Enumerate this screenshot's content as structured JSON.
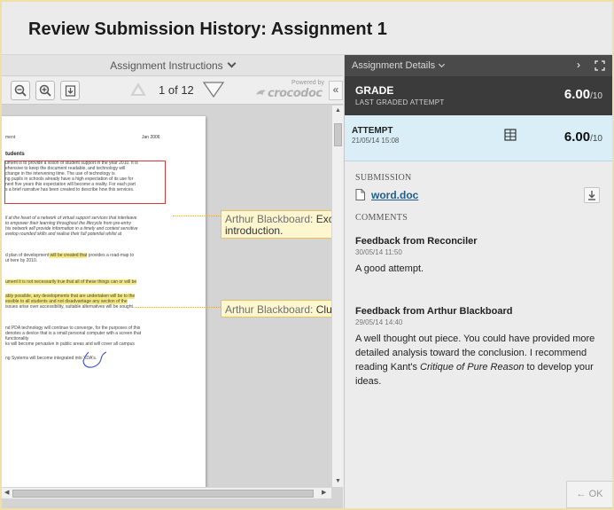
{
  "title": "Review Submission History: Assignment 1",
  "left": {
    "instructions_label": "Assignment Instructions",
    "toolbar": {
      "page_current": "1",
      "page_of": "of 12",
      "powered_by": "Powered by",
      "brand": "crocodoc",
      "collapse": "«"
    },
    "doc": {
      "line_ment": "ment",
      "date": "Jan 2006",
      "heading": "tudents",
      "box_lines": [
        "ument is to provide a vision of student support in the year 2010. It is",
        "ehensive to keep the document readable, and technology will",
        "change in the intervening time. The use of technology is",
        "ng pupils in schools already have a high expectation of its use for",
        "next five years this expectation will become a reality. For each part",
        "s a brief narrative has been created to describe how this services."
      ],
      "para2": [
        "ll at the heart of a network of virtual support services that interleave",
        "to empower their learning throughout the lifecycle from pre-entry",
        "his network will provide information in a timely and context sensitive",
        "evelop rounded skills and realise their full potential whilst at"
      ],
      "para3_a": "d plan of development",
      "para3_hl": " will be created that",
      "para3_b": " provides a road-map to",
      "para3_c": "ut here by 2010.",
      "para4": "ument it is not necessarily true that all of these things can or will be",
      "para5": [
        "ably possible, any developments that are undertaken will be to the",
        "essible to all students and not disadvantage any section of the",
        " issues arise over accessibility, suitable alternatives will be sought."
      ],
      "para6": [
        "nd PDA technology will continue to converge, for the purposes of this",
        "denotes a device that is a small personal computer with a screen that",
        "functionality",
        "ks will become pervasive in public areas and will cover all campus"
      ],
      "para7": "ng Systems will become integrated into XDA's."
    },
    "annotations": [
      {
        "author": "Arthur Blackboard:",
        "text": "Excellent introduction."
      },
      {
        "author": "Arthur Blackboard:",
        "text": "Clumsy"
      }
    ]
  },
  "right": {
    "details_label": "Assignment Details",
    "next": "›",
    "grade": {
      "label": "GRADE",
      "sub": "LAST GRADED ATTEMPT",
      "score": "6.00",
      "denom": "/10"
    },
    "attempt": {
      "label": "ATTEMPT",
      "date": "21/05/14 15:08",
      "score": "6.00",
      "denom": "/10"
    },
    "submission_label": "SUBMISSION",
    "file_name": "word.doc",
    "comments_label": "COMMENTS",
    "feedback": [
      {
        "from": "Feedback from Reconciler",
        "date": "30/05/14 11:50",
        "text": "A good attempt."
      },
      {
        "from": "Feedback from Arthur Blackboard",
        "date": "29/05/14 14:40",
        "text_pre": "A well thought out piece.  You could have provided more detailed analysis toward the conclusion.  I recommend reading Kant's ",
        "text_italic": "Critique of Pure Reason",
        "text_post": " to develop your ideas."
      }
    ],
    "ok_label": "← OK"
  },
  "colors": {
    "accent_link": "#1f5d8a",
    "attempt_bg": "#d9eef7",
    "grade_bg": "#3b3b3b",
    "highlight": "#f7ea7e",
    "annotation_border": "#e6c15e"
  }
}
